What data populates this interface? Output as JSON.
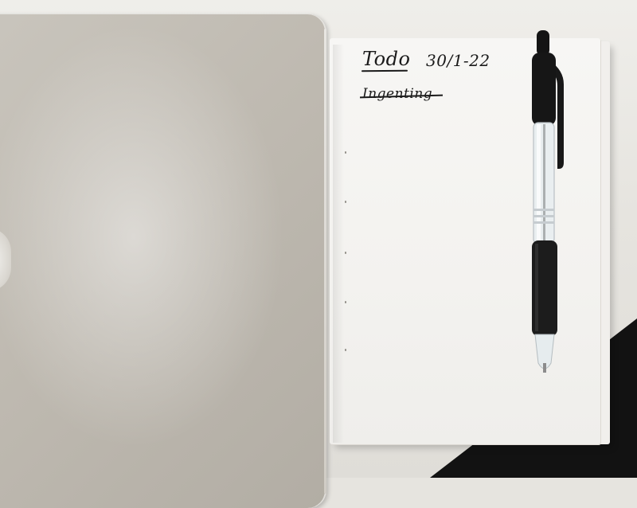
{
  "notebook": {
    "title": "Todo",
    "date": "30/1-22",
    "items": [
      {
        "text": "Ingenting",
        "struck": true
      }
    ]
  },
  "objects": {
    "laptop": "laptop-lid",
    "notebook": "notebook",
    "pen": "pen"
  },
  "colors": {
    "laptop": "#bfbab1",
    "page": "#f5f4f1",
    "ink": "#1a1a1a",
    "pen_grip": "#1c1c1c",
    "desk": "#e6e4df"
  }
}
